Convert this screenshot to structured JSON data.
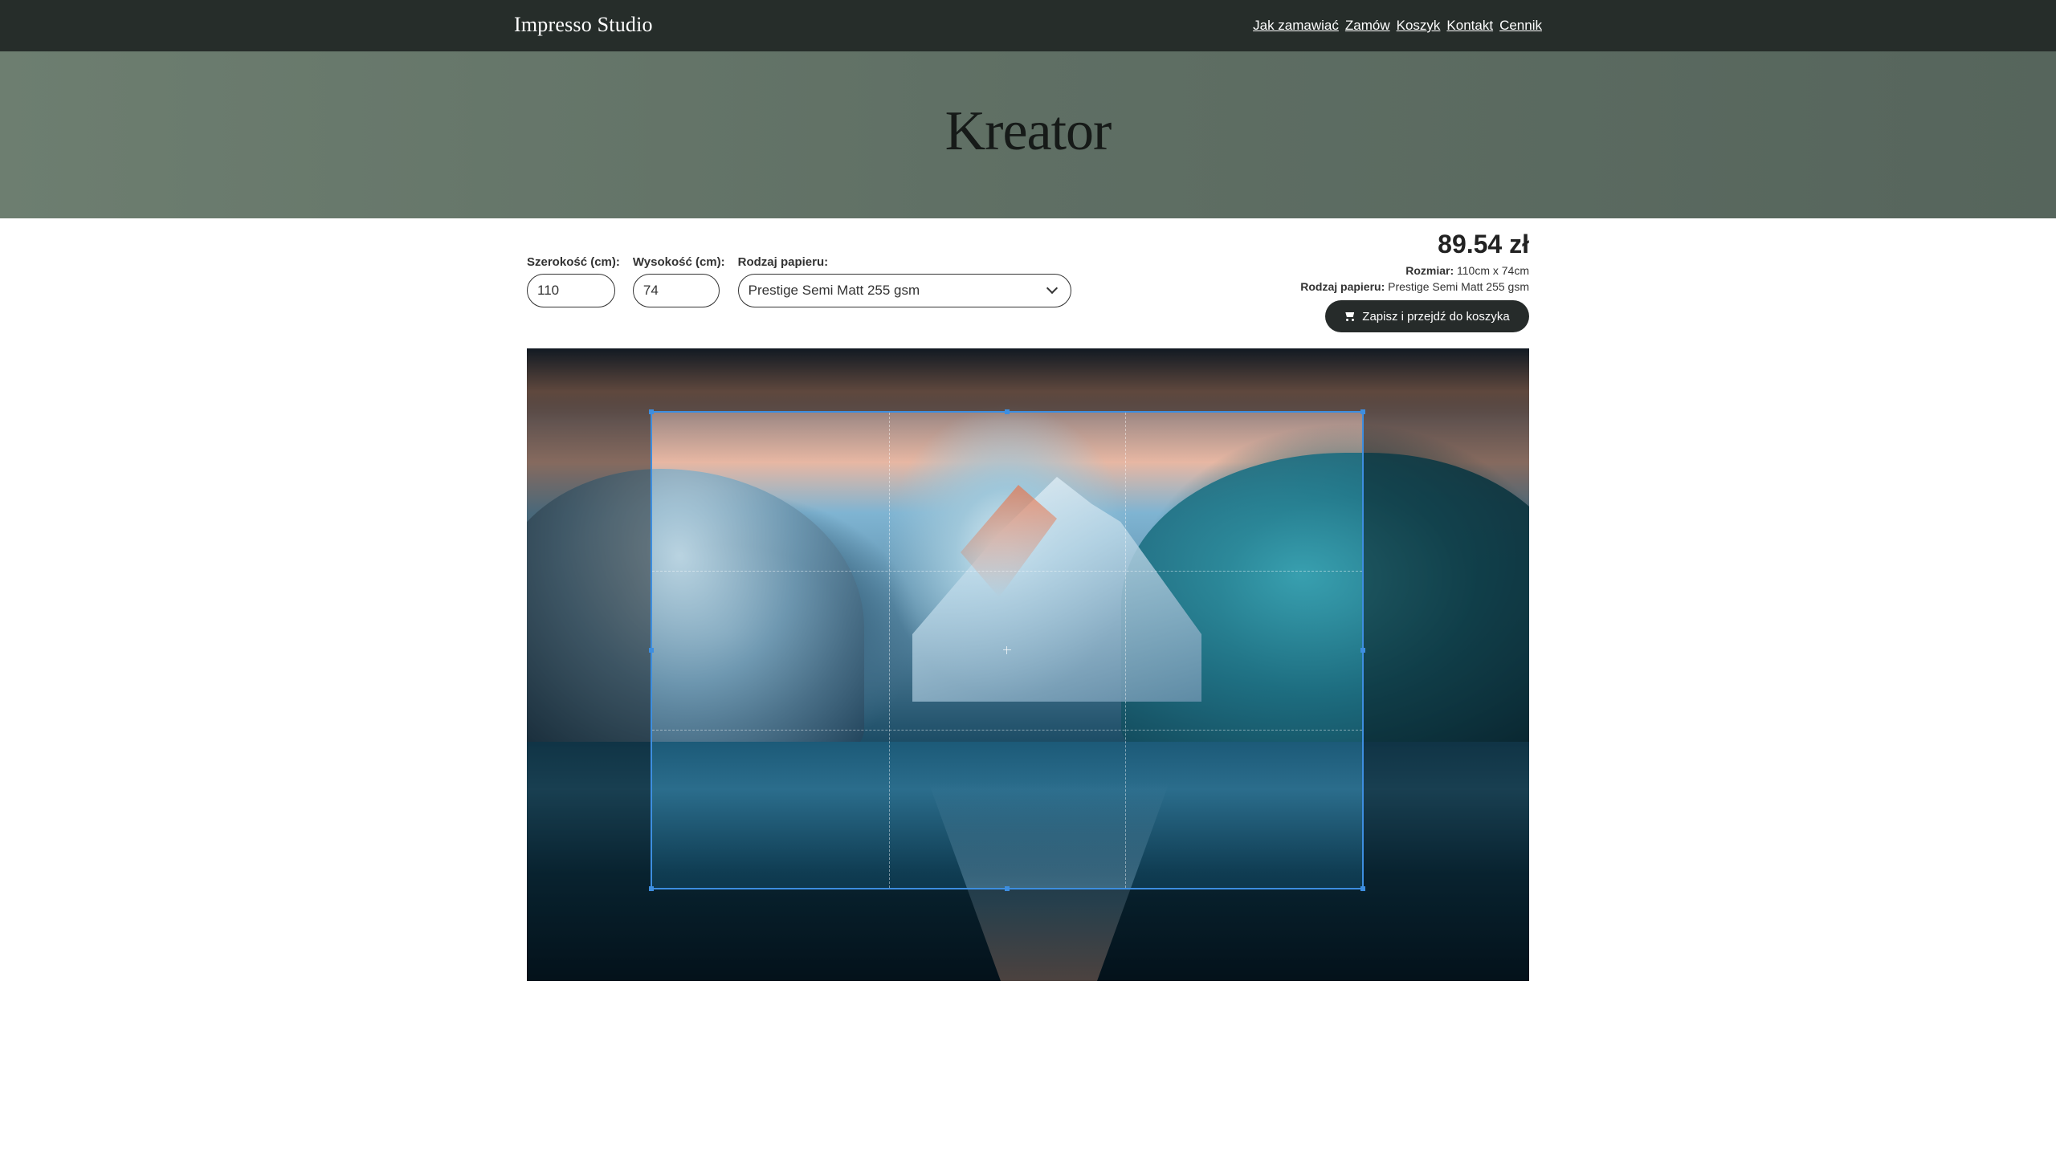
{
  "header": {
    "brand": "Impresso Studio",
    "nav": [
      "Jak zamawiać",
      "Zamów",
      "Koszyk",
      "Kontakt",
      "Cennik"
    ]
  },
  "hero": {
    "title": "Kreator"
  },
  "form": {
    "width_label": "Szerokość (cm):",
    "width_value": "110",
    "height_label": "Wysokość (cm):",
    "height_value": "74",
    "paper_label": "Rodzaj papieru:",
    "paper_value": "Prestige Semi Matt 255 gsm"
  },
  "summary": {
    "price": "89.54 zł",
    "size_label": "Rozmiar:",
    "size_value": "110cm x 74cm",
    "paper_label": "Rodzaj papieru:",
    "paper_value": "Prestige Semi Matt 255 gsm",
    "cta_label": "Zapisz i przejdź do koszyka"
  },
  "icons": {
    "cart": "cart-icon",
    "select": "chevron-down-icon"
  },
  "colors": {
    "topbar": "#262d2a",
    "hero": "#5f6f64",
    "cta": "#262b2a",
    "crop_border": "#3d8ee0"
  }
}
